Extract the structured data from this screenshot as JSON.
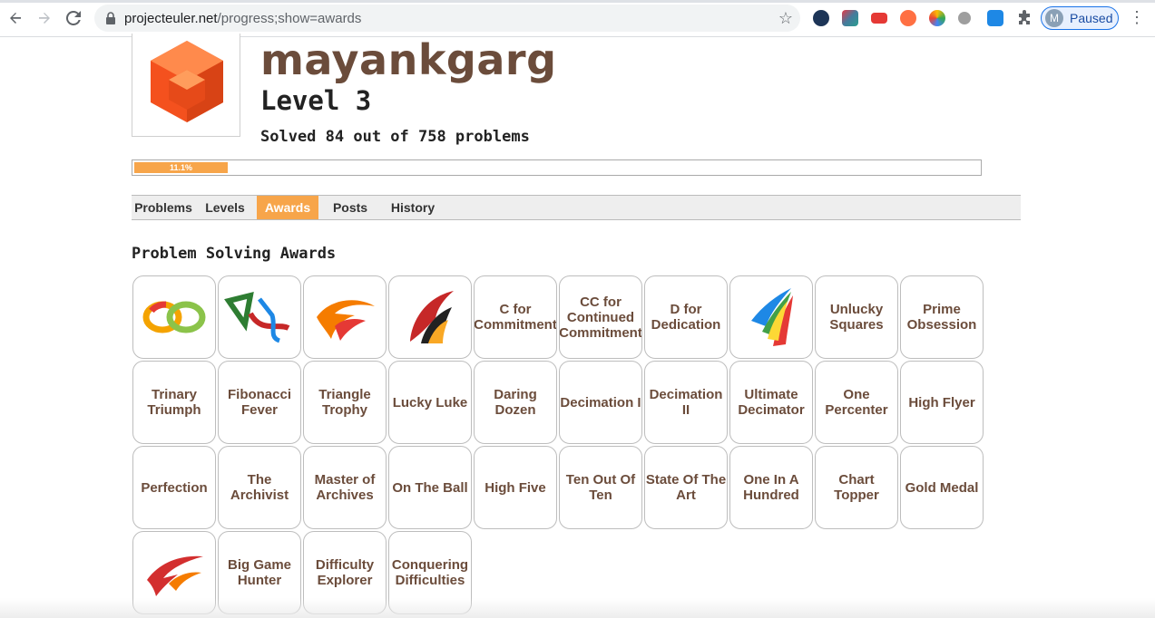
{
  "browser": {
    "url_host": "projecteuler.net",
    "url_path": "/progress;show=awards",
    "profile_initial": "M",
    "profile_status": "Paused"
  },
  "profile": {
    "username": "mayankgarg",
    "level": "Level 3",
    "solved": "Solved 84 out of 758 problems",
    "progress_text": "11.1%",
    "progress_fraction": 0.111
  },
  "tabs": [
    {
      "label": "Problems",
      "active": false
    },
    {
      "label": "Levels",
      "active": false
    },
    {
      "label": "Awards",
      "active": true
    },
    {
      "label": "Posts",
      "active": false
    },
    {
      "label": "History",
      "active": false
    }
  ],
  "section_title": "Problem Solving Awards",
  "awards": [
    {
      "label": "",
      "icon": "interlocking-rings-icon"
    },
    {
      "label": "",
      "icon": "ribbon-swirl-icon"
    },
    {
      "label": "",
      "icon": "orange-swoosh-icon"
    },
    {
      "label": "",
      "icon": "red-orange-wing-icon"
    },
    {
      "label": "C for Commitment"
    },
    {
      "label": "CC for Continued Commitment"
    },
    {
      "label": "D for Dedication"
    },
    {
      "label": "",
      "icon": "rainbow-streaks-icon"
    },
    {
      "label": "Unlucky Squares"
    },
    {
      "label": "Prime Obsession"
    },
    {
      "label": "Trinary Triumph"
    },
    {
      "label": "Fibonacci Fever"
    },
    {
      "label": "Triangle Trophy"
    },
    {
      "label": "Lucky Luke"
    },
    {
      "label": "Daring Dozen"
    },
    {
      "label": "Decimation I"
    },
    {
      "label": "Decimation II"
    },
    {
      "label": "Ultimate Decimator"
    },
    {
      "label": "One Percenter"
    },
    {
      "label": "High Flyer"
    },
    {
      "label": "Perfection"
    },
    {
      "label": "The Archivist"
    },
    {
      "label": "Master of Archives"
    },
    {
      "label": "On The Ball"
    },
    {
      "label": "High Five"
    },
    {
      "label": "Ten Out Of Ten"
    },
    {
      "label": "State Of The Art"
    },
    {
      "label": "One In A Hundred"
    },
    {
      "label": "Chart Topper"
    },
    {
      "label": "Gold Medal"
    },
    {
      "label": "",
      "icon": "red-flame-swoosh-icon"
    },
    {
      "label": "Big Game Hunter"
    },
    {
      "label": "Difficulty Explorer"
    },
    {
      "label": "Conquering Difficulties"
    }
  ],
  "colors": {
    "accent": "#f7a54a",
    "username": "#6b4c3b",
    "award_text": "#6b4c3b"
  }
}
